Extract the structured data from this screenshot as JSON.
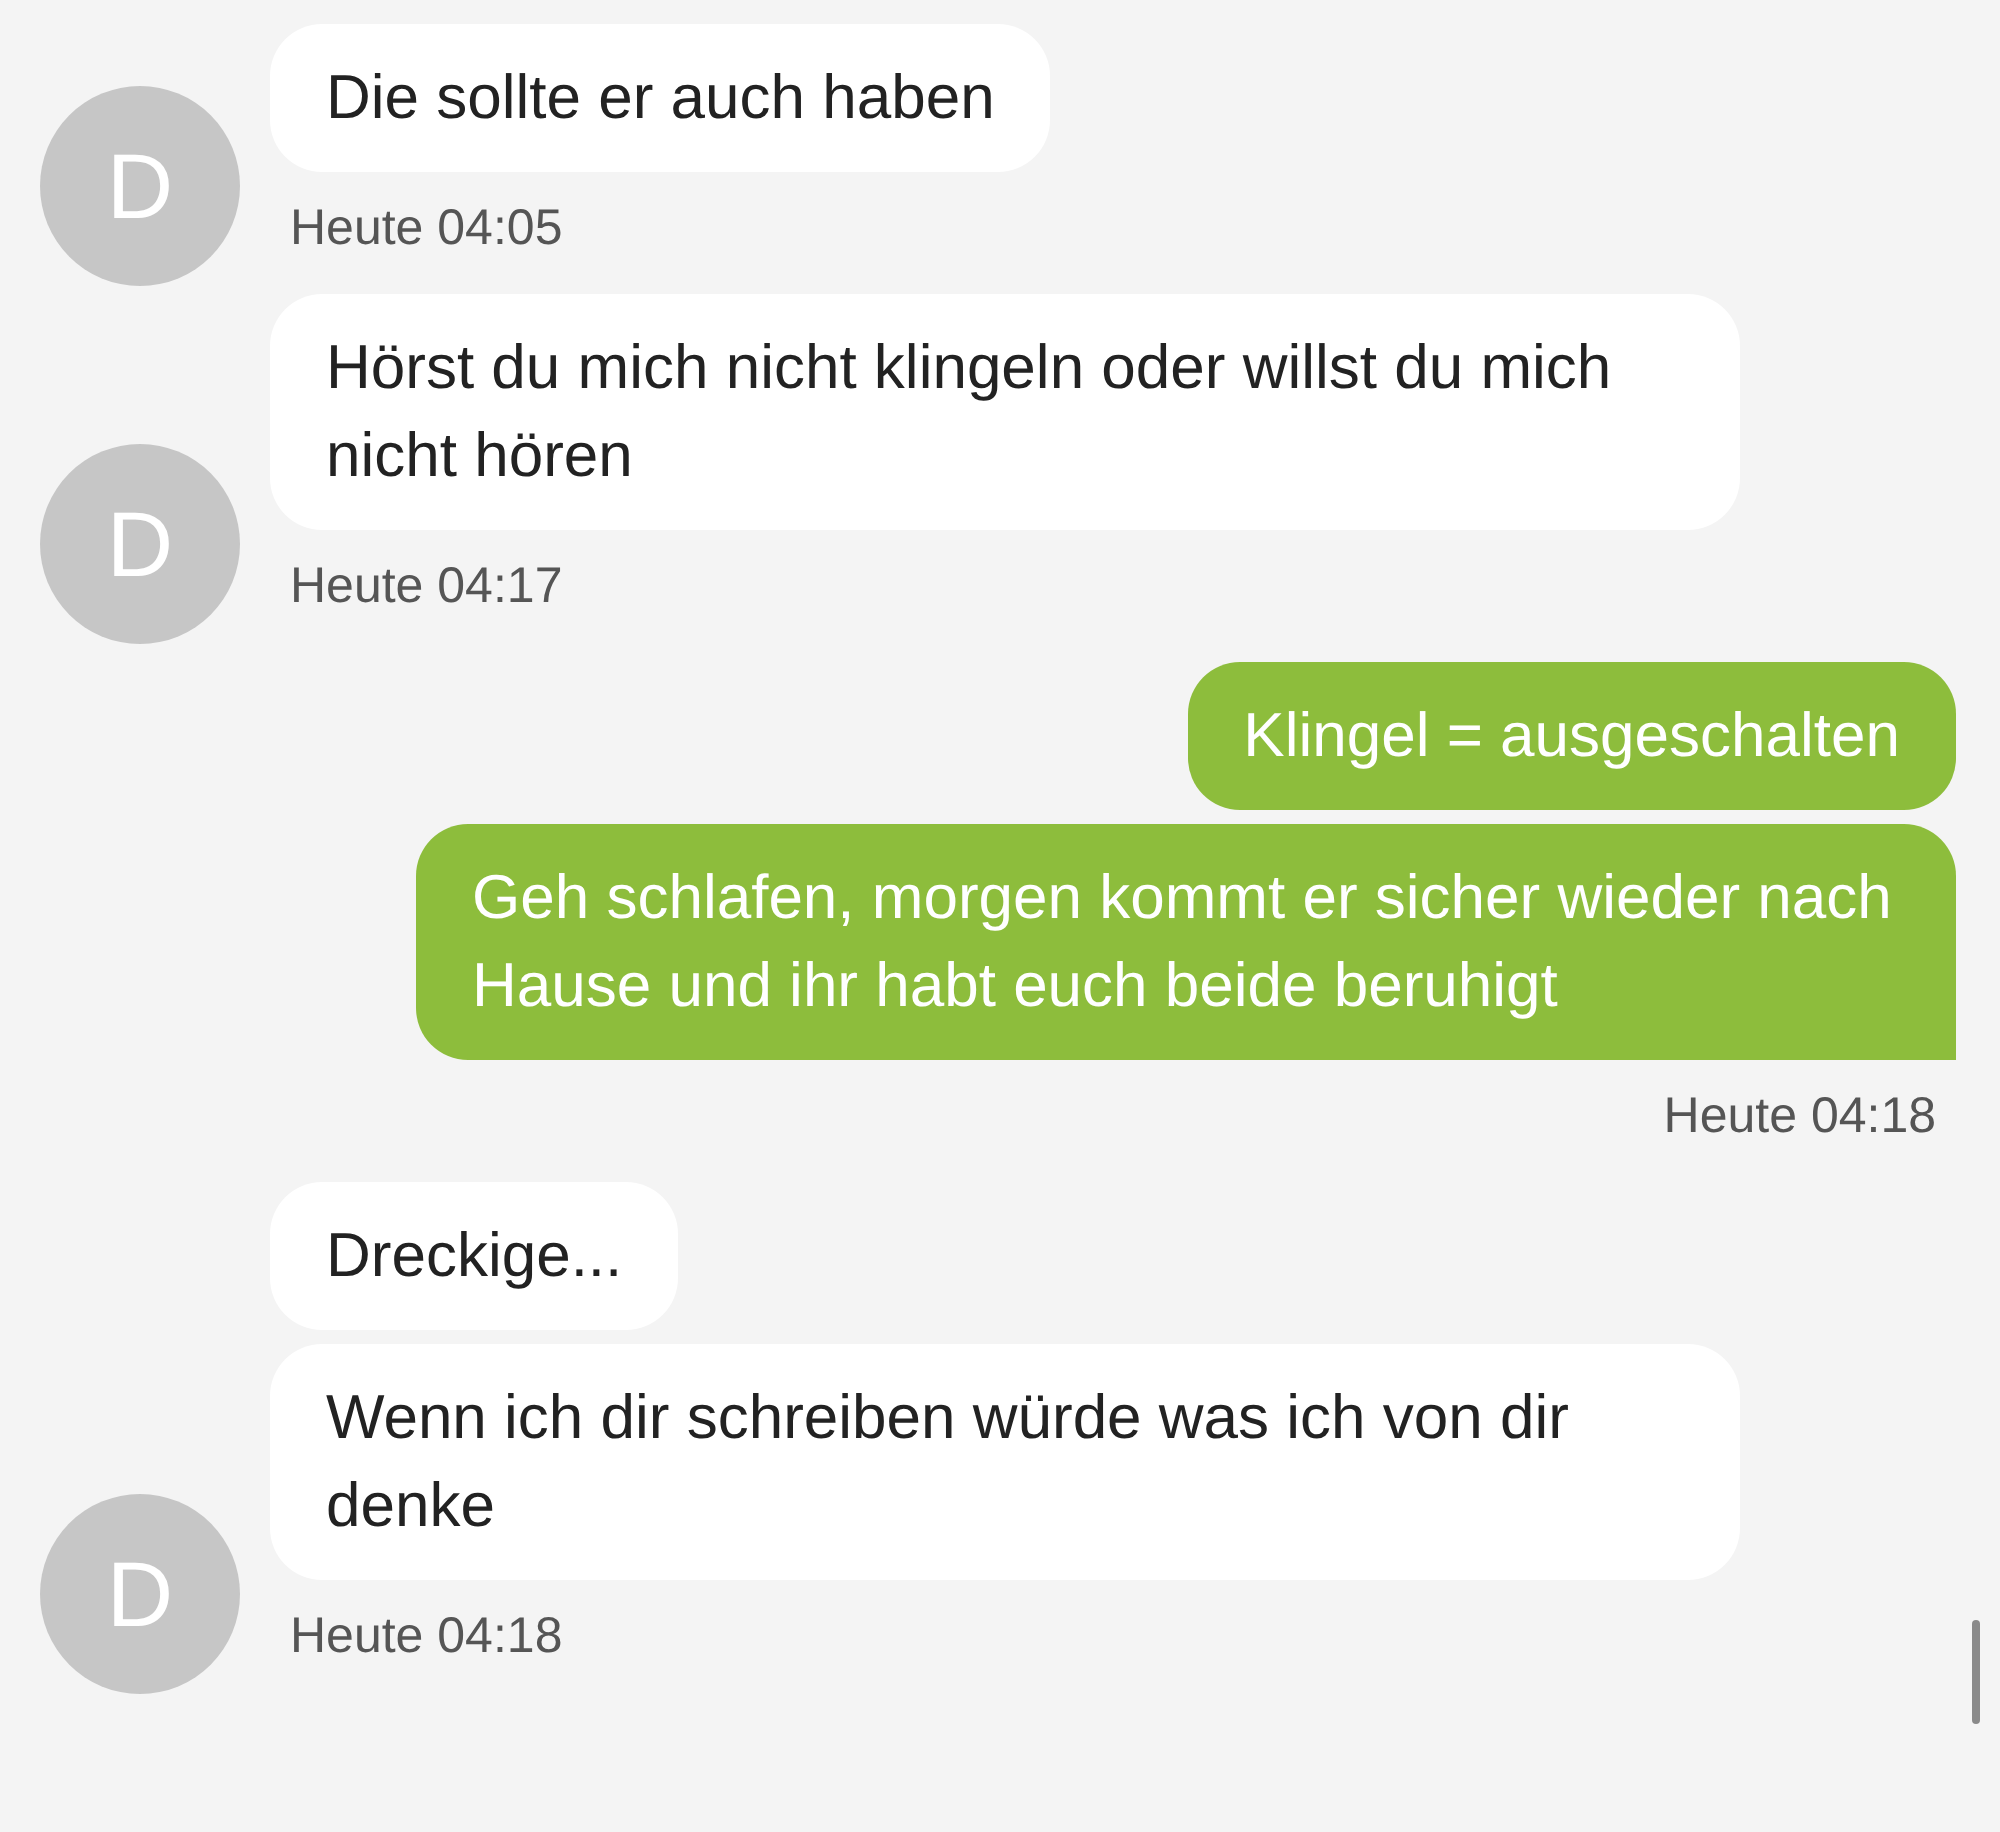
{
  "messages": [
    {
      "kind": "incoming",
      "avatar": "D",
      "bubbles": [
        "Die sollte er auch haben"
      ],
      "time": "Heute 04:05"
    },
    {
      "kind": "incoming",
      "avatar": "D",
      "bubbles": [
        "Hörst du mich nicht klingeln oder willst du mich nicht hören"
      ],
      "time": "Heute 04:17"
    },
    {
      "kind": "outgoing",
      "bubbles": [
        "Klingel = ausgeschalten",
        "Geh schlafen, morgen kommt er sicher wieder nach Hause und ihr habt euch beide beruhigt"
      ],
      "time": "Heute 04:18"
    },
    {
      "kind": "incoming",
      "avatar": "D",
      "bubbles": [
        "Dreckige...",
        "Wenn ich dir schreiben würde was ich von dir denke"
      ],
      "time": "Heute 04:18"
    }
  ]
}
